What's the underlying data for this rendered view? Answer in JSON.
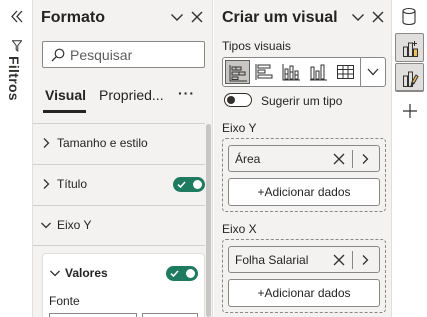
{
  "filters": {
    "label": "Filtros"
  },
  "format_pane": {
    "title": "Formato",
    "search_placeholder": "Pesquisar",
    "tabs": [
      {
        "label": "Visual",
        "active": true
      },
      {
        "label": "Propried...",
        "active": false
      }
    ],
    "more_label": "···",
    "sections": {
      "tamanho": {
        "label": "Tamanho e estilo",
        "expanded": false
      },
      "titulo": {
        "label": "Título",
        "expanded": false,
        "toggle_on": true
      },
      "eixo_y": {
        "label": "Eixo Y",
        "expanded": true
      },
      "valores": {
        "label": "Valores",
        "expanded": true,
        "toggle_on": true,
        "sub_label": "Fonte"
      }
    }
  },
  "build_pane": {
    "title": "Criar um visual",
    "visual_types_label": "Tipos visuais",
    "visual_types": [
      {
        "icon": "stacked-bar-icon",
        "selected": true
      },
      {
        "icon": "clustered-bar-icon",
        "selected": false
      },
      {
        "icon": "stacked-column-icon",
        "selected": false
      },
      {
        "icon": "clustered-column-icon",
        "selected": false
      },
      {
        "icon": "table-icon",
        "selected": false
      }
    ],
    "suggest_label": "Sugerir um tipo",
    "suggest_on": false,
    "wells": {
      "y": {
        "label": "Eixo Y",
        "field": "Área",
        "add_label": "+Adicionar dados"
      },
      "x": {
        "label": "Eixo X",
        "field": "Folha Salarial",
        "add_label": "+Adicionar dados"
      }
    }
  },
  "right_rail": {
    "icons": [
      "database-icon",
      "build-visual-icon",
      "format-visual-icon",
      "add-icon"
    ]
  },
  "colors": {
    "toggle_on": "#1e7b5f",
    "pane_bg": "#f3f2f1",
    "selected_bg": "#c8c6c4",
    "text": "#252423"
  }
}
